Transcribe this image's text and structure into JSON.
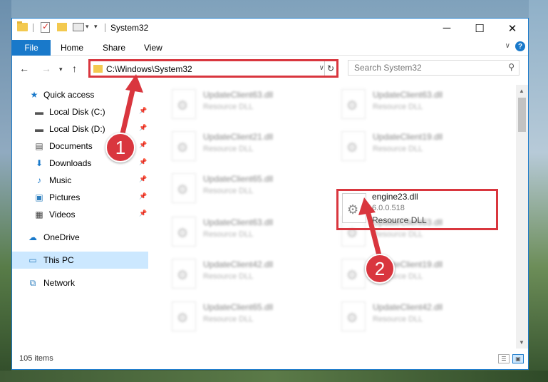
{
  "window": {
    "title": "System32"
  },
  "ribbon": {
    "tabs": [
      "File",
      "Home",
      "Share",
      "View"
    ],
    "help": "?"
  },
  "address": {
    "path": "C:\\Windows\\System32",
    "search_placeholder": "Search System32"
  },
  "nav": {
    "quick_access": "Quick access",
    "items": [
      {
        "label": "Local Disk (C:)"
      },
      {
        "label": "Local Disk (D:)"
      },
      {
        "label": "Documents"
      },
      {
        "label": "Downloads"
      },
      {
        "label": "Music"
      },
      {
        "label": "Pictures"
      },
      {
        "label": "Videos"
      }
    ],
    "onedrive": "OneDrive",
    "thispc": "This PC",
    "network": "Network"
  },
  "files": {
    "left": [
      {
        "name": "UpdateClient63.dll",
        "type": "Resource DLL"
      },
      {
        "name": "UpdateClient21.dll",
        "type": "Resource DLL"
      },
      {
        "name": "UpdateClient65.dll",
        "type": "Resource DLL"
      },
      {
        "name": "UpdateClient63.dll",
        "type": "Resource DLL"
      },
      {
        "name": "UpdateClient42.dll",
        "type": "Resource DLL"
      },
      {
        "name": "UpdateClient65.dll",
        "type": "Resource DLL"
      }
    ],
    "right": [
      {
        "name": "UpdateClient63.dll",
        "type": "Resource DLL"
      },
      {
        "name": "UpdateClient19.dll",
        "type": "Resource DLL"
      },
      {
        "name": "UpdateClient63.dll",
        "type": "Resource DLL"
      },
      {
        "name": "UpdateClient19.dll",
        "type": "Resource DLL"
      },
      {
        "name": "UpdateClient42.dll",
        "type": "Resource DLL"
      }
    ],
    "highlighted": {
      "name": "engine23.dll",
      "version": "6.0.0.518",
      "type": "Resource DLL"
    }
  },
  "status": {
    "count": "105 items"
  },
  "callouts": {
    "one": "1",
    "two": "2"
  },
  "colors": {
    "accent": "#1979ca",
    "highlight": "#d9363e",
    "selected": "#cce8ff"
  }
}
